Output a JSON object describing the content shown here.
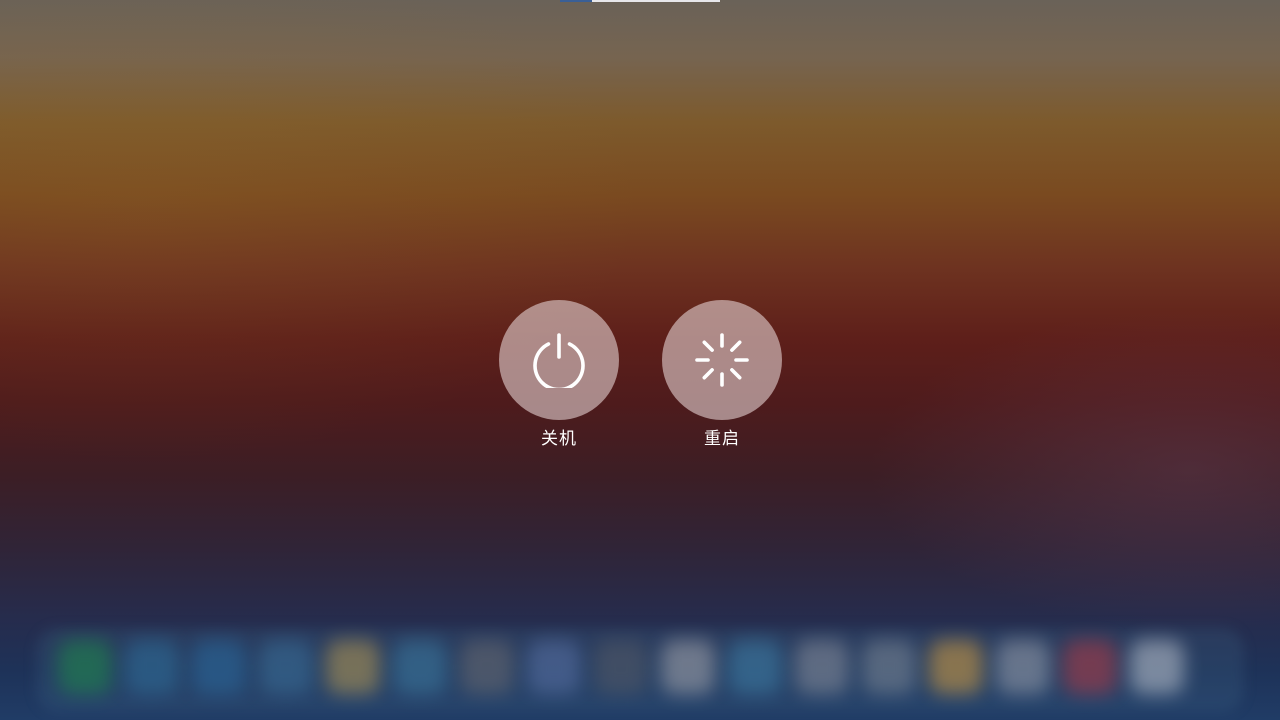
{
  "screen": {
    "title": ""
  },
  "power_menu": {
    "options": [
      {
        "id": "shutdown",
        "label": "关机",
        "icon": "power-icon"
      },
      {
        "id": "restart",
        "label": "重启",
        "icon": "spinner-icon"
      }
    ]
  },
  "top_progress": {
    "fraction": 0.2,
    "fill_color": "#3a5f96",
    "track_color": "#ebebf0"
  },
  "dock": {
    "icon_colors": [
      "#1f8a4a",
      "#2e6e9a",
      "#2a6a9e",
      "#3a6f99",
      "#b89a52",
      "#3c7aa0",
      "#6a6a70",
      "#5a72a6",
      "#555a66",
      "#a8a8ae",
      "#3f80a8",
      "#8a8f9c",
      "#7d8896",
      "#d8a040",
      "#9aa0ad",
      "#b33a44",
      "#c0c6d0"
    ]
  }
}
